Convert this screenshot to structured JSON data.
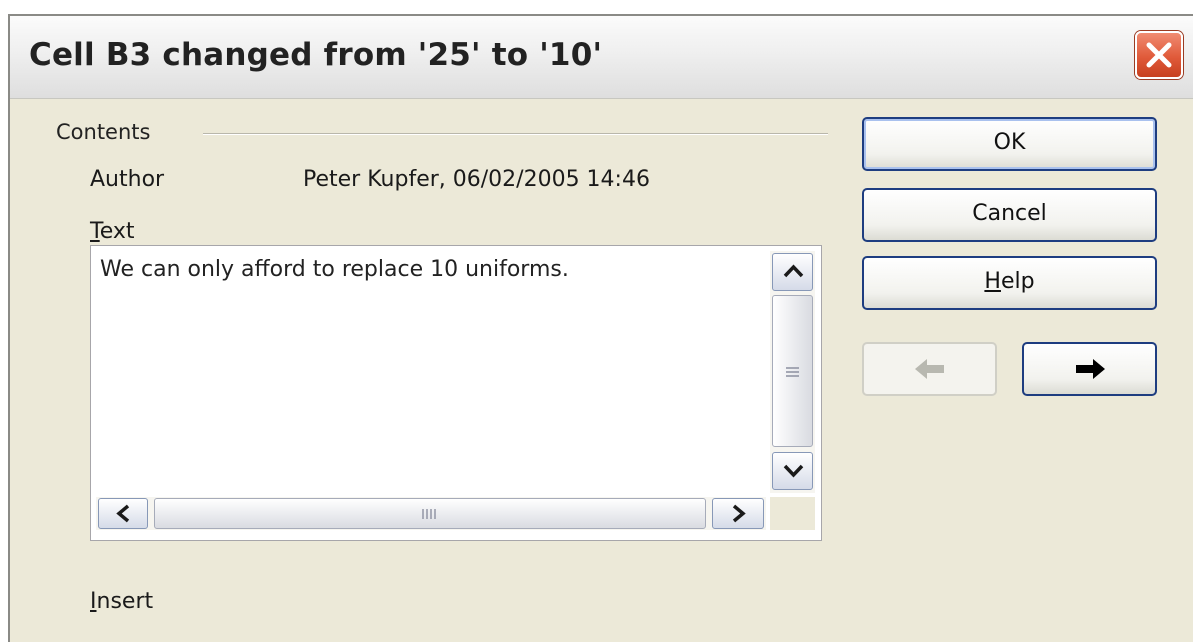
{
  "dialog": {
    "title": "Cell B3 changed from '25' to '10'",
    "close_icon": "close-x-icon"
  },
  "contents": {
    "group_label": "Contents",
    "author_label": "Author",
    "author_value": "Peter Kupfer, 06/02/2005 14:46",
    "text_label_mnemonic": "T",
    "text_label_rest": "ext",
    "text_value": "We can only afford to replace 10 uniforms.",
    "insert_label_mnemonic": "I",
    "insert_label_rest": "nsert"
  },
  "buttons": {
    "ok": "OK",
    "cancel": "Cancel",
    "help_mnemonic": "H",
    "help_rest": "elp",
    "previous_icon": "arrow-left-icon",
    "next_icon": "arrow-right-icon"
  },
  "colors": {
    "dialog_background": "#ece9d8",
    "close_button": "#e05a3a",
    "button_border": "#1e3d80"
  }
}
